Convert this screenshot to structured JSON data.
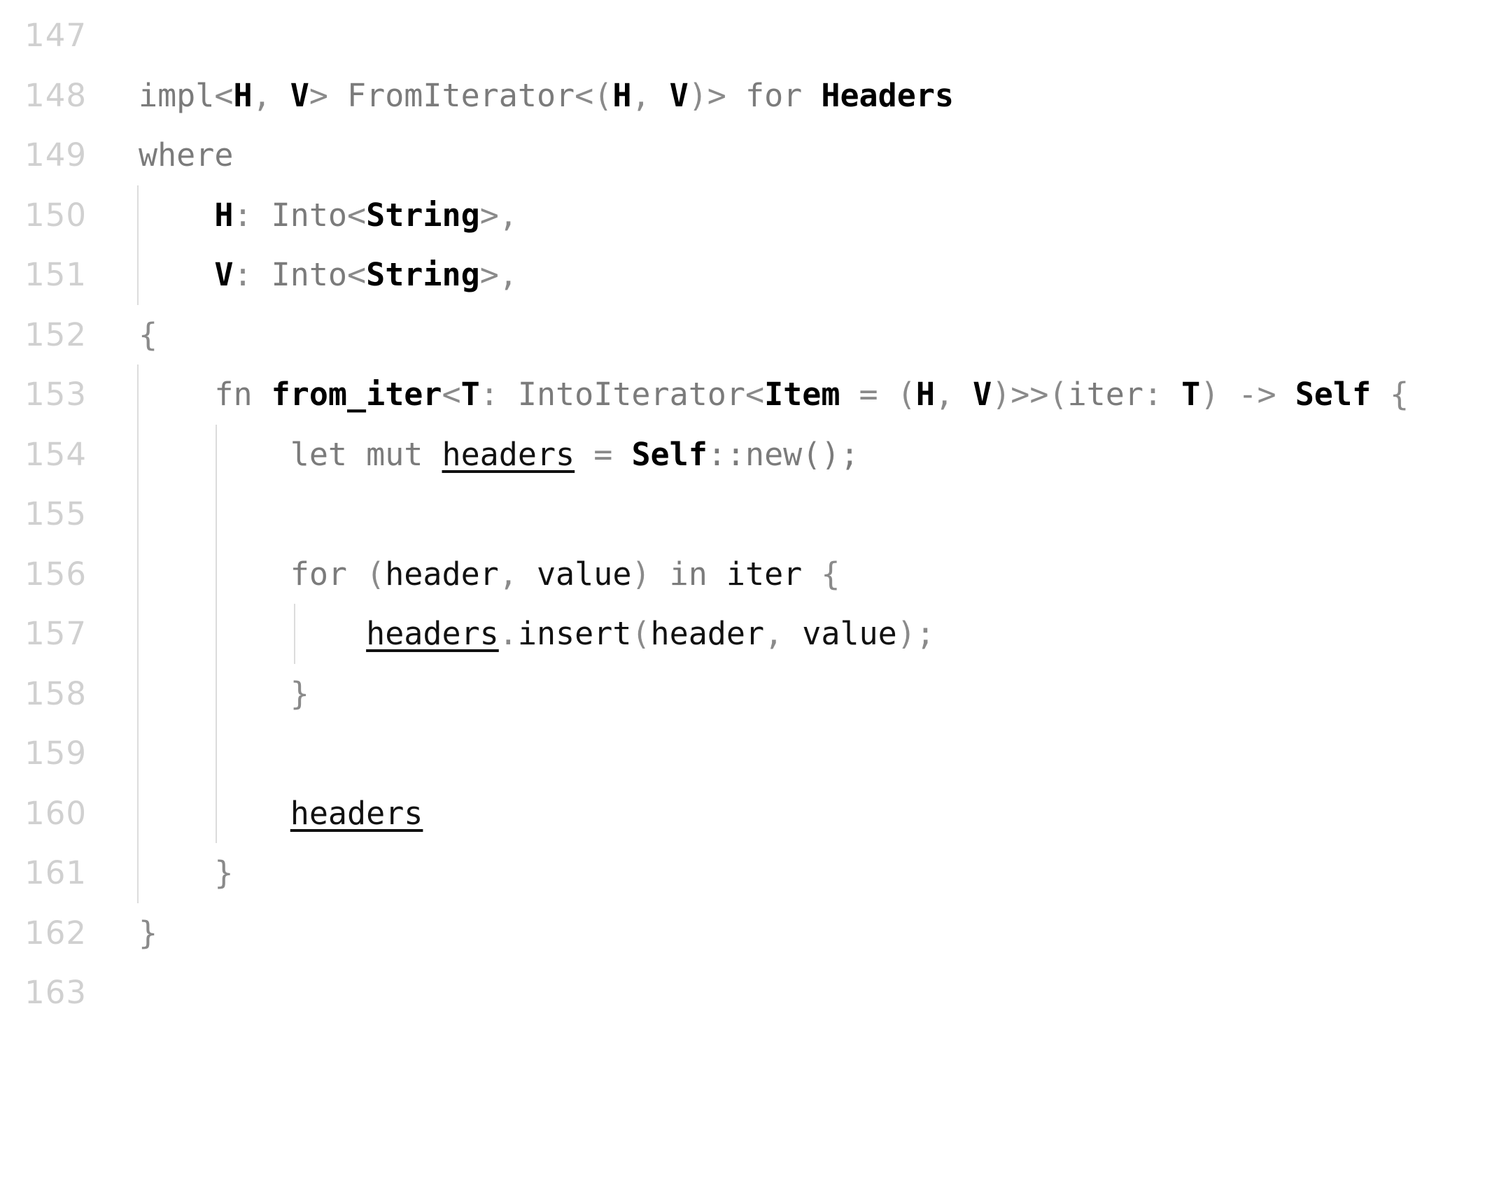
{
  "editor": {
    "language": "rust",
    "colors": {
      "background": "#ffffff",
      "gutter_text": "#d0d0d0",
      "default_text": "#7b7b7b",
      "emphasis_text": "#000000",
      "indent_guide": "#dcdcdc"
    },
    "first_visible_line": 147,
    "last_visible_line": 163
  },
  "lines": [
    {
      "number": "147",
      "text": ""
    },
    {
      "number": "148",
      "text": "impl<H, V> FromIterator<(H, V)> for Headers"
    },
    {
      "number": "149",
      "text": "where"
    },
    {
      "number": "150",
      "text": "    H: Into<String>,"
    },
    {
      "number": "151",
      "text": "    V: Into<String>,"
    },
    {
      "number": "152",
      "text": "{"
    },
    {
      "number": "153",
      "text": "    fn from_iter<T: IntoIterator<Item = (H, V)>>(iter: T) -> Self {"
    },
    {
      "number": "154",
      "text": "        let mut headers = Self::new();"
    },
    {
      "number": "155",
      "text": ""
    },
    {
      "number": "156",
      "text": "        for (header, value) in iter {"
    },
    {
      "number": "157",
      "text": "            headers.insert(header, value);"
    },
    {
      "number": "158",
      "text": "        }"
    },
    {
      "number": "159",
      "text": ""
    },
    {
      "number": "160",
      "text": "        headers"
    },
    {
      "number": "161",
      "text": "    }"
    },
    {
      "number": "162",
      "text": "}"
    },
    {
      "number": "163",
      "text": ""
    }
  ],
  "tokens": {
    "l148": {
      "impl": "impl",
      "lt": "<",
      "h": "H",
      "comma1": ", ",
      "v": "V",
      "gt": "> ",
      "fromiterator": "FromIterator",
      "lt2": "<(",
      "h2": "H",
      "comma2": ", ",
      "v2": "V",
      "gt2": ")> ",
      "for": "for ",
      "headers": "Headers"
    },
    "l149": {
      "where": "where"
    },
    "l150": {
      "indent": "    ",
      "h": "H",
      "colon": ": ",
      "into": "Into",
      "lt": "<",
      "string": "String",
      "gt": ">,"
    },
    "l151": {
      "indent": "    ",
      "v": "V",
      "colon": ": ",
      "into": "Into",
      "lt": "<",
      "string": "String",
      "gt": ">,"
    },
    "l152": {
      "brace": "{"
    },
    "l153": {
      "indent": "    ",
      "fn": "fn ",
      "name": "from_iter",
      "lt": "<",
      "t": "T",
      "colon": ": ",
      "intoiterator": "IntoIterator",
      "lt2": "<",
      "item": "Item",
      "eq": " = (",
      "h": "H",
      "comma": ", ",
      "v": "V",
      "gt": ")>>(",
      "iter": "iter",
      "colon2": ": ",
      "t2": "T",
      "arrow": ") -> ",
      "self": "Self",
      "brace": " {"
    },
    "l154": {
      "indent": "        ",
      "let": "let mut ",
      "headers": "headers",
      "eq": " = ",
      "self": "Self",
      "new": "::new();"
    },
    "l156": {
      "indent": "        ",
      "for": "for ",
      "lparen": "(",
      "header": "header",
      "comma": ", ",
      "value": "value",
      "rparen": ") ",
      "in": "in ",
      "iter": "iter",
      "brace": " {"
    },
    "l157": {
      "indent": "            ",
      "headers": "headers",
      "dot": ".",
      "insert": "insert",
      "lparen": "(",
      "header": "header",
      "comma": ", ",
      "value": "value",
      "rparen": ");"
    },
    "l158": {
      "indent": "        ",
      "brace": "}"
    },
    "l160": {
      "indent": "        ",
      "headers": "headers"
    },
    "l161": {
      "indent": "    ",
      "brace": "}"
    },
    "l162": {
      "brace": "}"
    }
  }
}
